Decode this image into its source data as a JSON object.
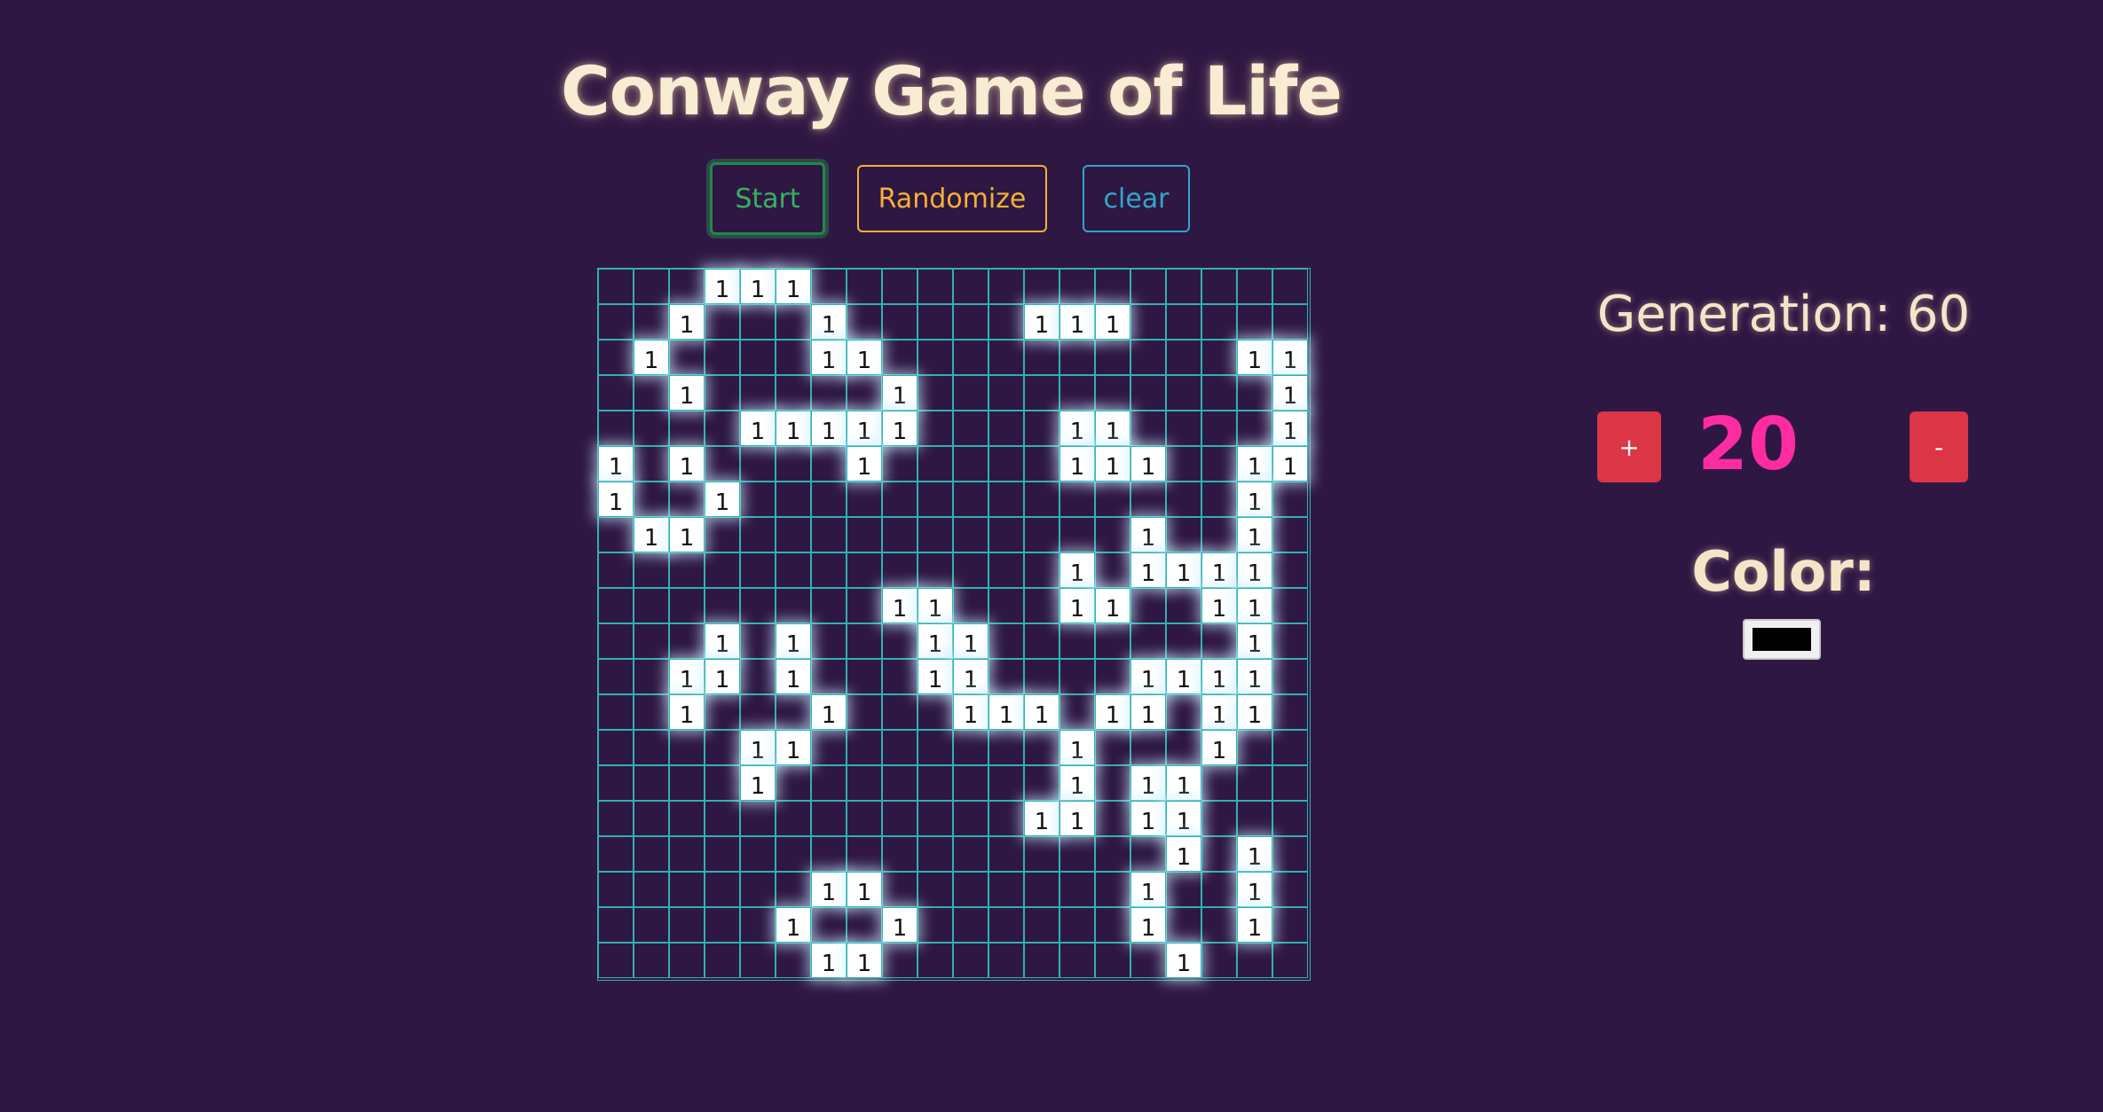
{
  "title": "Conway Game of Life",
  "controls": {
    "start_label": "Start",
    "randomize_label": "Randomize",
    "clear_label": "clear"
  },
  "grid": {
    "rows": 20,
    "cols": 20,
    "cell_label": "1",
    "alive": [
      [
        0,
        3
      ],
      [
        0,
        4
      ],
      [
        0,
        5
      ],
      [
        1,
        2
      ],
      [
        1,
        6
      ],
      [
        1,
        12
      ],
      [
        1,
        13
      ],
      [
        1,
        14
      ],
      [
        2,
        1
      ],
      [
        2,
        6
      ],
      [
        2,
        7
      ],
      [
        2,
        18
      ],
      [
        2,
        19
      ],
      [
        3,
        2
      ],
      [
        3,
        8
      ],
      [
        3,
        19
      ],
      [
        4,
        4
      ],
      [
        4,
        5
      ],
      [
        4,
        6
      ],
      [
        4,
        7
      ],
      [
        4,
        8
      ],
      [
        4,
        13
      ],
      [
        4,
        14
      ],
      [
        4,
        19
      ],
      [
        5,
        0
      ],
      [
        5,
        2
      ],
      [
        5,
        7
      ],
      [
        5,
        13
      ],
      [
        5,
        14
      ],
      [
        5,
        15
      ],
      [
        5,
        18
      ],
      [
        5,
        19
      ],
      [
        6,
        0
      ],
      [
        6,
        3
      ],
      [
        6,
        18
      ],
      [
        7,
        1
      ],
      [
        7,
        2
      ],
      [
        7,
        15
      ],
      [
        7,
        18
      ],
      [
        8,
        13
      ],
      [
        8,
        15
      ],
      [
        8,
        16
      ],
      [
        8,
        17
      ],
      [
        8,
        18
      ],
      [
        9,
        8
      ],
      [
        9,
        9
      ],
      [
        9,
        13
      ],
      [
        9,
        14
      ],
      [
        9,
        17
      ],
      [
        9,
        18
      ],
      [
        10,
        3
      ],
      [
        10,
        5
      ],
      [
        10,
        9
      ],
      [
        10,
        10
      ],
      [
        10,
        18
      ],
      [
        11,
        2
      ],
      [
        11,
        3
      ],
      [
        11,
        5
      ],
      [
        11,
        9
      ],
      [
        11,
        10
      ],
      [
        11,
        15
      ],
      [
        11,
        16
      ],
      [
        11,
        17
      ],
      [
        11,
        18
      ],
      [
        12,
        2
      ],
      [
        12,
        6
      ],
      [
        12,
        10
      ],
      [
        12,
        11
      ],
      [
        12,
        12
      ],
      [
        12,
        14
      ],
      [
        12,
        15
      ],
      [
        12,
        17
      ],
      [
        12,
        18
      ],
      [
        13,
        4
      ],
      [
        13,
        5
      ],
      [
        13,
        13
      ],
      [
        13,
        17
      ],
      [
        14,
        4
      ],
      [
        14,
        13
      ],
      [
        14,
        15
      ],
      [
        14,
        16
      ],
      [
        15,
        12
      ],
      [
        15,
        13
      ],
      [
        15,
        15
      ],
      [
        15,
        16
      ],
      [
        16,
        16
      ],
      [
        16,
        18
      ],
      [
        17,
        6
      ],
      [
        17,
        7
      ],
      [
        17,
        15
      ],
      [
        17,
        18
      ],
      [
        18,
        5
      ],
      [
        18,
        8
      ],
      [
        18,
        15
      ],
      [
        18,
        18
      ],
      [
        19,
        6
      ],
      [
        19,
        7
      ],
      [
        19,
        16
      ]
    ]
  },
  "generation_text": "Generation: 60",
  "speed": {
    "plus_label": "+",
    "value": "20",
    "minus_label": "-"
  },
  "color": {
    "label": "Color:",
    "value": "#000000"
  },
  "colors": {
    "background": "#2f1744",
    "grid_line": "#2fb0b3",
    "alive_cell": "#ffffff",
    "start": "#34b35c",
    "randomize": "#f2b233",
    "clear": "#2fa7c8",
    "step_button": "#dc3545",
    "speed_value": "#ff2ba0"
  }
}
